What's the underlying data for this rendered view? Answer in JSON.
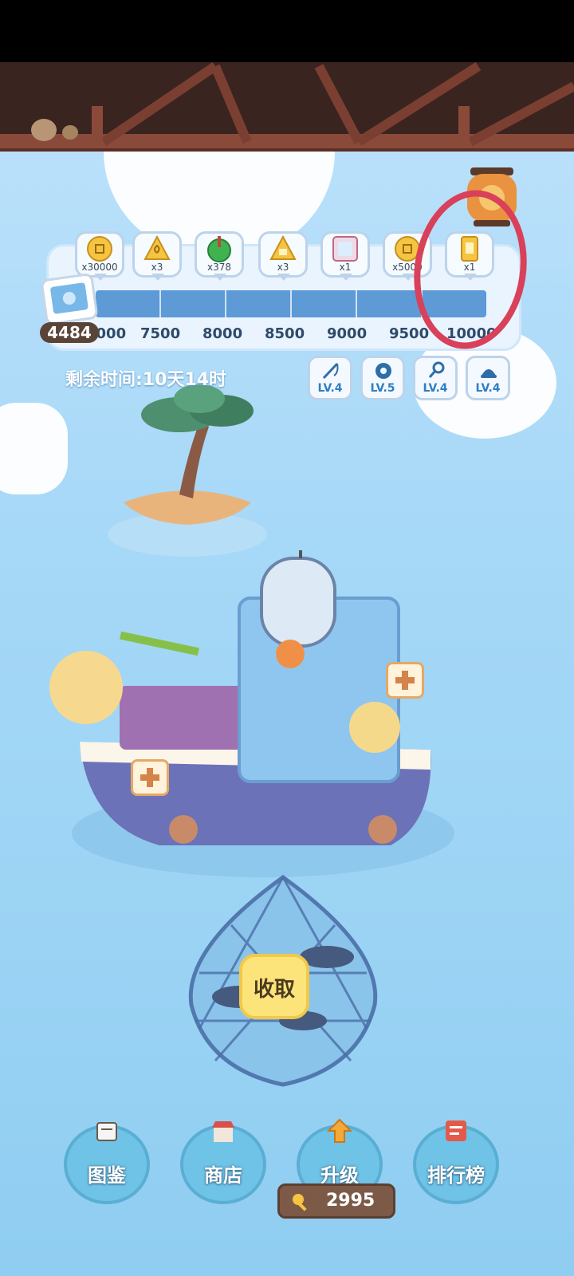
{
  "rewards": [
    {
      "icon": "coin-icon",
      "count": "x30000"
    },
    {
      "icon": "shell-icon",
      "count": "x3"
    },
    {
      "icon": "bait-icon",
      "count": "x378"
    },
    {
      "icon": "ticket-triangle-icon",
      "count": "x3"
    },
    {
      "icon": "frame-icon",
      "count": "x1"
    },
    {
      "icon": "coin-icon",
      "count": "x5000"
    },
    {
      "icon": "gold-card-icon",
      "count": "x1"
    }
  ],
  "milestones": [
    "7000",
    "7500",
    "8000",
    "8500",
    "9000",
    "9500",
    "10000"
  ],
  "score": "4484",
  "progress": 0.0,
  "timer": "剩余时间:10天14时",
  "levels": [
    {
      "icon": "fishing-rod-icon",
      "label": "LV.4"
    },
    {
      "icon": "reel-icon",
      "label": "LV.5"
    },
    {
      "icon": "hook-icon",
      "label": "LV.4"
    },
    {
      "icon": "hat-icon",
      "label": "LV.4"
    }
  ],
  "collect_label": "收取",
  "nav": [
    {
      "icon": "book-icon",
      "label": "图鉴"
    },
    {
      "icon": "shop-icon",
      "label": "商店"
    },
    {
      "icon": "upgrade-arrow-icon",
      "label": "升级"
    },
    {
      "icon": "leaderboard-icon",
      "label": "排行榜"
    }
  ],
  "currency": "2995",
  "colors": {
    "annotation": "#d9405a",
    "sea": "#9fd4f5",
    "bar": "#5d9ad6"
  }
}
